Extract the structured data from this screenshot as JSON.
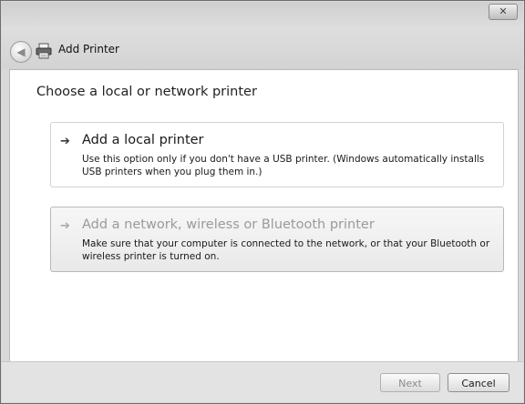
{
  "window": {
    "title": "Add Printer",
    "close_label": "✕"
  },
  "content": {
    "heading": "Choose a local or network printer",
    "options": [
      {
        "title": "Add a local printer",
        "description": "Use this option only if you don't have a USB printer. (Windows automatically installs USB printers when you plug them in.)"
      },
      {
        "title": "Add a network, wireless or Bluetooth printer",
        "description": "Make sure that your computer is connected to the network, or that your Bluetooth or wireless printer is turned on."
      }
    ]
  },
  "footer": {
    "next_label": "Next",
    "cancel_label": "Cancel"
  },
  "icons": {
    "back": "back-arrow-icon",
    "printer": "printer-icon",
    "option_arrow": "green-arrow-icon",
    "close": "close-icon"
  }
}
